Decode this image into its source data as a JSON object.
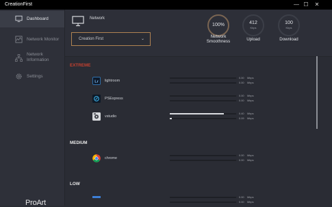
{
  "window": {
    "title": "CreationFirst",
    "controls": [
      "—",
      "☐",
      "✕"
    ]
  },
  "sidebar": {
    "items": [
      {
        "label": "Dashboard",
        "icon": "monitor-icon",
        "active": true
      },
      {
        "label": "Network Monitor",
        "icon": "network-monitor-icon",
        "active": false
      },
      {
        "label": "Network\nInformation",
        "icon": "network-info-icon",
        "active": false
      },
      {
        "label": "Settings",
        "icon": "gear-icon",
        "active": false
      }
    ],
    "logo": "ProArt"
  },
  "header": {
    "network_label": "Network",
    "profile_value": "Creation First",
    "gauges": [
      {
        "value": "100%",
        "unit": "",
        "label": "Network\nSmoothness"
      },
      {
        "value": "412",
        "unit": "Kbps",
        "label": "Upload"
      },
      {
        "value": "100",
        "unit": "Kbps",
        "label": "Download"
      }
    ]
  },
  "sections": [
    {
      "title": "EXTREME",
      "apps": [
        {
          "name": "lightroom",
          "icon": "lightroom-icon",
          "upload": "0.00",
          "download": "0.00",
          "unit": "Mbps",
          "upload_fill": 0,
          "download_fill": 0
        },
        {
          "name": "PSExpress",
          "icon": "psexpress-icon",
          "upload": "0.00",
          "download": "0.00",
          "unit": "Mbps",
          "upload_fill": 0,
          "download_fill": 0
        },
        {
          "name": "vstudio",
          "icon": "vstudio-icon",
          "upload": "0.40",
          "download": "0.09",
          "unit": "Mbps",
          "upload_fill": 0.81,
          "download_fill": 0.03
        }
      ]
    },
    {
      "title": "MEDIUM",
      "apps": [
        {
          "name": "chrome",
          "icon": "chrome-icon",
          "upload": "0.00",
          "download": "0.00",
          "unit": "Mbps",
          "upload_fill": 0,
          "download_fill": 0
        }
      ]
    },
    {
      "title": "LOW",
      "apps": [
        {
          "name": "",
          "icon": "app-icon",
          "upload": "0.00",
          "download": "0.00",
          "unit": "Mbps",
          "upload_fill": 0,
          "download_fill": 0
        }
      ]
    }
  ],
  "colors": {
    "accent": "#b08352",
    "extreme": "#c4402f",
    "background": "#2a2c34"
  }
}
